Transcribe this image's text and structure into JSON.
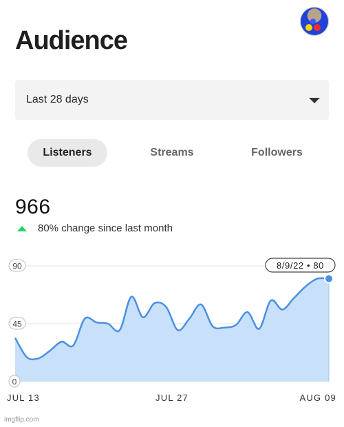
{
  "header": {
    "title": "Audience"
  },
  "filter": {
    "selected": "Last 28 days"
  },
  "tabs": [
    {
      "label": "Listeners",
      "active": true
    },
    {
      "label": "Streams",
      "active": false
    },
    {
      "label": "Followers",
      "active": false
    }
  ],
  "summary": {
    "value": "966",
    "change_text": "80% change since last month",
    "trend": "up",
    "trend_color": "#1ed760"
  },
  "chart_data": {
    "type": "area",
    "ylim": [
      0,
      90
    ],
    "y_ticks": [
      "90",
      "45",
      "0"
    ],
    "x_tick_labels": [
      "JUL 13",
      "JUL 27",
      "AUG 09"
    ],
    "tooltip": "8/9/22 • 80",
    "fill_color": "#c9e0fb",
    "line_color": "#4a90e2",
    "series": [
      {
        "x": [
          "2022-07-13",
          "2022-07-14",
          "2022-07-15",
          "2022-07-16",
          "2022-07-17",
          "2022-07-18",
          "2022-07-19",
          "2022-07-20",
          "2022-07-21",
          "2022-07-22",
          "2022-07-23",
          "2022-07-24",
          "2022-07-25",
          "2022-07-26",
          "2022-07-27",
          "2022-07-28",
          "2022-07-29",
          "2022-07-30",
          "2022-07-31",
          "2022-08-01",
          "2022-08-02",
          "2022-08-03",
          "2022-08-04",
          "2022-08-05",
          "2022-08-06",
          "2022-08-07",
          "2022-08-08",
          "2022-08-09"
        ],
        "values": [
          34,
          19,
          18,
          24,
          31,
          28,
          49,
          46,
          45,
          40,
          66,
          50,
          61,
          58,
          40,
          49,
          60,
          43,
          42,
          44,
          54,
          41,
          63,
          56,
          65,
          74,
          80,
          80
        ]
      }
    ]
  },
  "footer": {
    "watermark": "imgflip.com"
  }
}
